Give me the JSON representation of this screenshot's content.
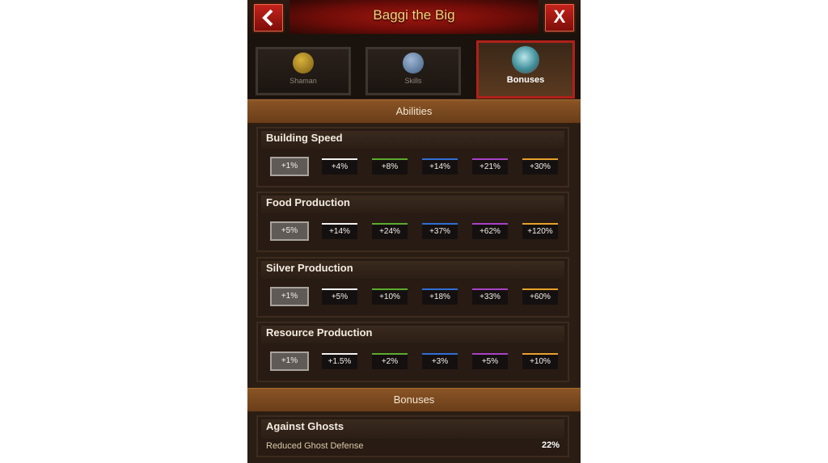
{
  "header": {
    "title": "Baggi the Big",
    "back_icon": "chevron-left-icon",
    "close_label": "X"
  },
  "tabs": [
    {
      "label": "Shaman",
      "icon": "shaman-emblem-icon",
      "active": false
    },
    {
      "label": "Skills",
      "icon": "skills-book-icon",
      "active": false
    },
    {
      "label": "Bonuses",
      "icon": "bonuses-orb-icon",
      "active": true
    }
  ],
  "abilities": {
    "heading": "Abilities",
    "groups": [
      {
        "title": "Building Speed",
        "values": [
          "+1%",
          "+4%",
          "+8%",
          "+14%",
          "+21%",
          "+30%"
        ]
      },
      {
        "title": "Food Production",
        "values": [
          "+5%",
          "+14%",
          "+24%",
          "+37%",
          "+62%",
          "+120%"
        ]
      },
      {
        "title": "Silver Production",
        "values": [
          "+1%",
          "+5%",
          "+10%",
          "+18%",
          "+33%",
          "+60%"
        ]
      },
      {
        "title": "Resource Production",
        "values": [
          "+1%",
          "+1.5%",
          "+2%",
          "+3%",
          "+5%",
          "+10%"
        ]
      }
    ]
  },
  "bonuses": {
    "heading": "Bonuses",
    "ghost": {
      "title": "Against Ghosts",
      "row_label": "Reduced Ghost Defense",
      "row_value": "22%"
    }
  },
  "colors": {
    "tier_white": "#f2f2f2",
    "tier_green": "#5cab2e",
    "tier_blue": "#2f6fd6",
    "tier_purple": "#a842c7",
    "tier_gold": "#e8a22a",
    "accent_red": "#b02018",
    "title_gold": "#f3d27a"
  }
}
